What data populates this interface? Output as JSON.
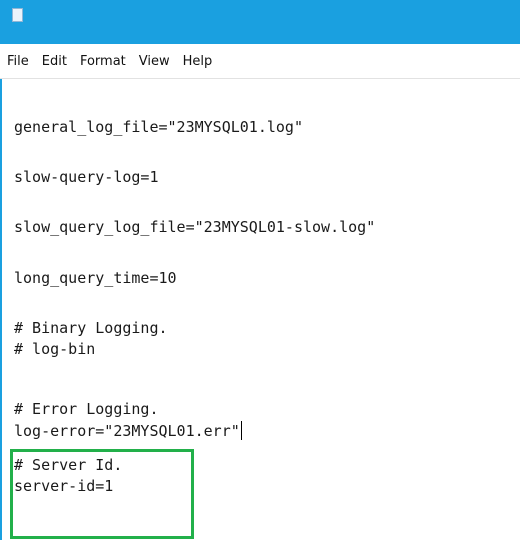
{
  "menubar": {
    "items": [
      "File",
      "Edit",
      "Format",
      "View",
      "Help"
    ]
  },
  "editor": {
    "lines": [
      "general_log_file=\"23MYSQL01.log\"",
      "slow-query-log=1",
      "slow_query_log_file=\"23MYSQL01-slow.log\"",
      "long_query_time=10",
      "# Binary Logging.",
      "# log-bin",
      "# Error Logging.",
      "log-error=\"23MYSQL01.err\"",
      "# Server Id.",
      "server-id=1"
    ]
  },
  "colors": {
    "titlebar": "#1aa0e0",
    "highlight": "#22b04a"
  }
}
